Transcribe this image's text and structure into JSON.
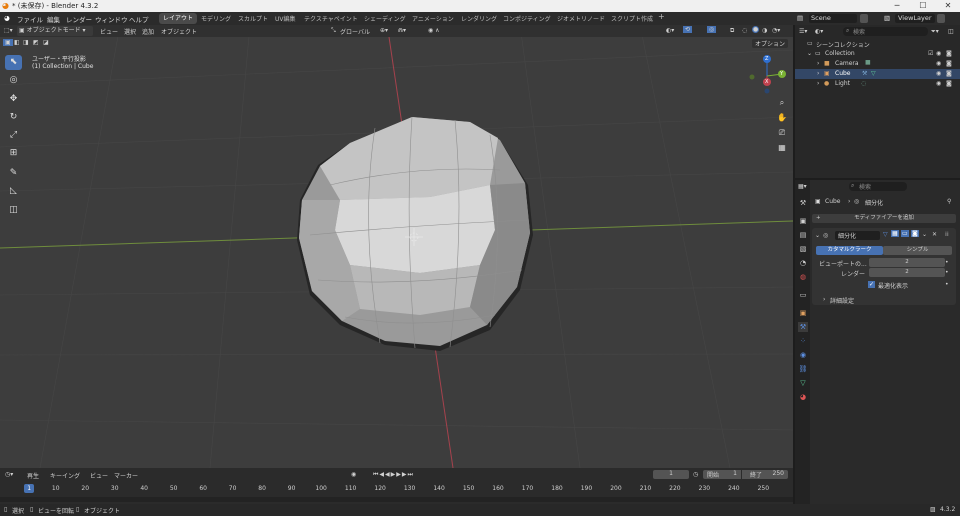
{
  "window": {
    "title": "* (未保存) - Blender 4.3.2",
    "minimize": "─",
    "maximize": "☐",
    "close": "✕"
  },
  "menu": {
    "items": [
      "ファイル",
      "編集",
      "レンダー",
      "ウィンドウ",
      "ヘルプ"
    ]
  },
  "workspaces": {
    "tabs": [
      "レイアウト",
      "モデリング",
      "スカルプト",
      "UV編集",
      "テクスチャペイント",
      "シェーディング",
      "アニメーション",
      "レンダリング",
      "コンポジティング",
      "ジオメトリノード",
      "スクリプト作成"
    ],
    "add": "+"
  },
  "scene": {
    "name": "Scene",
    "view_layer": "ViewLayer"
  },
  "viewport": {
    "mode": "オブジェクトモード",
    "menus": [
      "ビュー",
      "選択",
      "追加",
      "オブジェクト"
    ],
    "transform": "グローバル",
    "options": "オプション",
    "view_name": "ユーザー・平行投影",
    "collection_path": "(1) Collection | Cube",
    "gizmo": {
      "z": "Z",
      "y": "Y",
      "x": "X"
    }
  },
  "outliner": {
    "root": "シーンコレクション",
    "collection": "Collection",
    "items": [
      {
        "name": "Camera"
      },
      {
        "name": "Cube"
      },
      {
        "name": "Light"
      }
    ],
    "search_placeholder": "検索"
  },
  "properties": {
    "search_placeholder": "検索",
    "breadcrumb_object": "Cube",
    "breadcrumb_modifier": "細分化",
    "add_modifier": "モディファイアーを追加",
    "modifier_name": "細分化",
    "catmull": "カタマルクラーク",
    "simple": "シンプル",
    "viewport_label": "ビューポートの...",
    "viewport_value": "2",
    "render_label": "レンダー",
    "render_value": "2",
    "optimal_label": "最適化表示",
    "advanced": "詳細設定"
  },
  "timeline": {
    "menus": [
      "再生",
      "キーイング",
      "ビュー",
      "マーカー"
    ],
    "current_frame": "1",
    "start_label": "開始",
    "start": "1",
    "end_label": "終了",
    "end": "250",
    "ticks": [
      "1",
      "10",
      "20",
      "30",
      "40",
      "50",
      "60",
      "70",
      "80",
      "90",
      "100",
      "110",
      "120",
      "130",
      "140",
      "150",
      "160",
      "170",
      "180",
      "190",
      "200",
      "210",
      "220",
      "230",
      "240",
      "250"
    ]
  },
  "status": {
    "select": "選択",
    "rotate": "ビューを回転",
    "object": "オブジェクト",
    "version": "4.3.2"
  },
  "colors": {
    "accent": "#4772b3",
    "x_axis": "#c0424e",
    "y_axis": "#7ab234",
    "z_axis": "#2f6fd0"
  }
}
